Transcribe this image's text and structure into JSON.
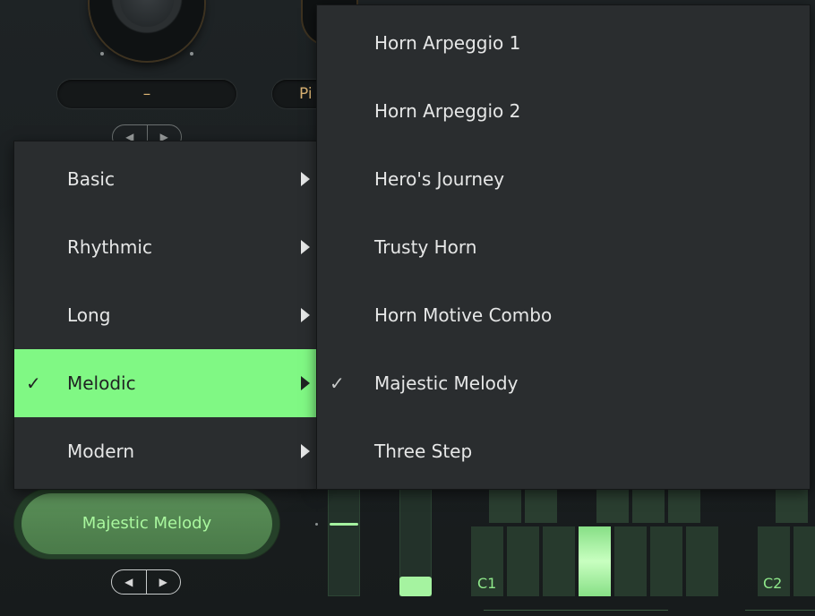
{
  "top_controls": {
    "left_value": "–",
    "mid_value": "Pi"
  },
  "category_menu": {
    "items": [
      {
        "label": "Basic",
        "checked": false,
        "has_submenu": true
      },
      {
        "label": "Rhythmic",
        "checked": false,
        "has_submenu": true
      },
      {
        "label": "Long",
        "checked": false,
        "has_submenu": true
      },
      {
        "label": "Melodic",
        "checked": true,
        "has_submenu": true
      },
      {
        "label": "Modern",
        "checked": false,
        "has_submenu": true
      }
    ],
    "active_index": 3,
    "highlight_color": "#80f884"
  },
  "pattern_menu": {
    "items": [
      {
        "label": "Horn Arpeggio 1",
        "checked": false
      },
      {
        "label": "Horn Arpeggio 2",
        "checked": false
      },
      {
        "label": "Hero's Journey",
        "checked": false
      },
      {
        "label": "Trusty Horn",
        "checked": false
      },
      {
        "label": "Horn Motive Combo",
        "checked": false
      },
      {
        "label": "Majestic Melody",
        "checked": true
      },
      {
        "label": "Three Step",
        "checked": false
      }
    ]
  },
  "pattern_selector": {
    "current": "Majestic Melody"
  },
  "keyboard": {
    "labels": [
      "C1",
      "C2"
    ],
    "accent_color": "#a5f3a0"
  },
  "icons": {
    "check": "✓",
    "stepper_prev": "◀",
    "stepper_next": "▶"
  }
}
